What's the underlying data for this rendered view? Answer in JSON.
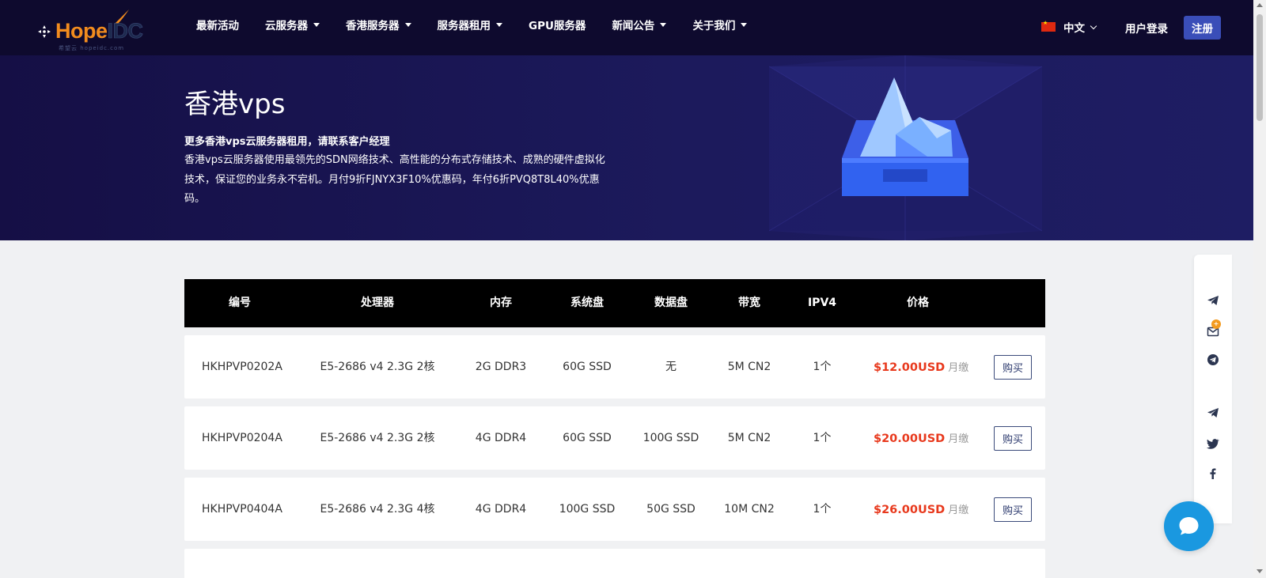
{
  "brand": {
    "logo_hope": "Hope",
    "logo_idc": "IDC",
    "logo_sub": "希望云 hopeidc.com"
  },
  "nav": [
    {
      "label": "最新活动",
      "dropdown": false
    },
    {
      "label": "云服务器",
      "dropdown": true
    },
    {
      "label": "香港服务器",
      "dropdown": true
    },
    {
      "label": "服务器租用",
      "dropdown": true
    },
    {
      "label": "GPU服务器",
      "dropdown": false
    },
    {
      "label": "新闻公告",
      "dropdown": true
    },
    {
      "label": "关于我们",
      "dropdown": true
    }
  ],
  "header": {
    "language": "中文",
    "login": "用户登录",
    "register": "注册"
  },
  "hero": {
    "title": "香港vps",
    "subtitle": "更多香港vps云服务器租用，请联系客户经理",
    "description": "香港vps云服务器使用最领先的SDN网络技术、高性能的分布式存储技术、成熟的硬件虚拟化技术，保证您的业务永不宕机。月付9折FJNYX3F10%优惠码，年付6折PVQ8T8L40%优惠码。"
  },
  "table": {
    "columns": [
      "编号",
      "处理器",
      "内存",
      "系统盘",
      "数据盘",
      "带宽",
      "IPV4",
      "价格"
    ],
    "buy_label": "购买",
    "price_unit": "月缴",
    "rows": [
      {
        "id": "HKHPVP0202A",
        "cpu": "E5-2686 v4 2.3G 2核",
        "ram": "2G DDR3",
        "sys_disk": "60G SSD",
        "data_disk": "无",
        "bandwidth": "5M CN2",
        "ipv4": "1个",
        "price": "$12.00USD"
      },
      {
        "id": "HKHPVP0204A",
        "cpu": "E5-2686 v4 2.3G 2核",
        "ram": "4G DDR4",
        "sys_disk": "60G SSD",
        "data_disk": "100G SSD",
        "bandwidth": "5M CN2",
        "ipv4": "1个",
        "price": "$20.00USD"
      },
      {
        "id": "HKHPVP0404A",
        "cpu": "E5-2686 v4 2.3G 4核",
        "ram": "4G DDR4",
        "sys_disk": "100G SSD",
        "data_disk": "50G SSD",
        "bandwidth": "10M CN2",
        "ipv4": "1个",
        "price": "$26.00USD"
      }
    ]
  },
  "float_bar": {
    "icons": [
      "telegram-icon",
      "mail-icon",
      "telegram-circle-icon",
      "telegram-icon",
      "twitter-icon",
      "facebook-icon"
    ],
    "mail_badge": "+"
  },
  "colors": {
    "header_bg": "#0e0a2e",
    "hero_bg": "#1c1a5c",
    "accent_orange": "#f28c1e",
    "price_red": "#e8391d",
    "register_blue": "#3a4eb8",
    "chat_blue": "#1a98e0"
  }
}
